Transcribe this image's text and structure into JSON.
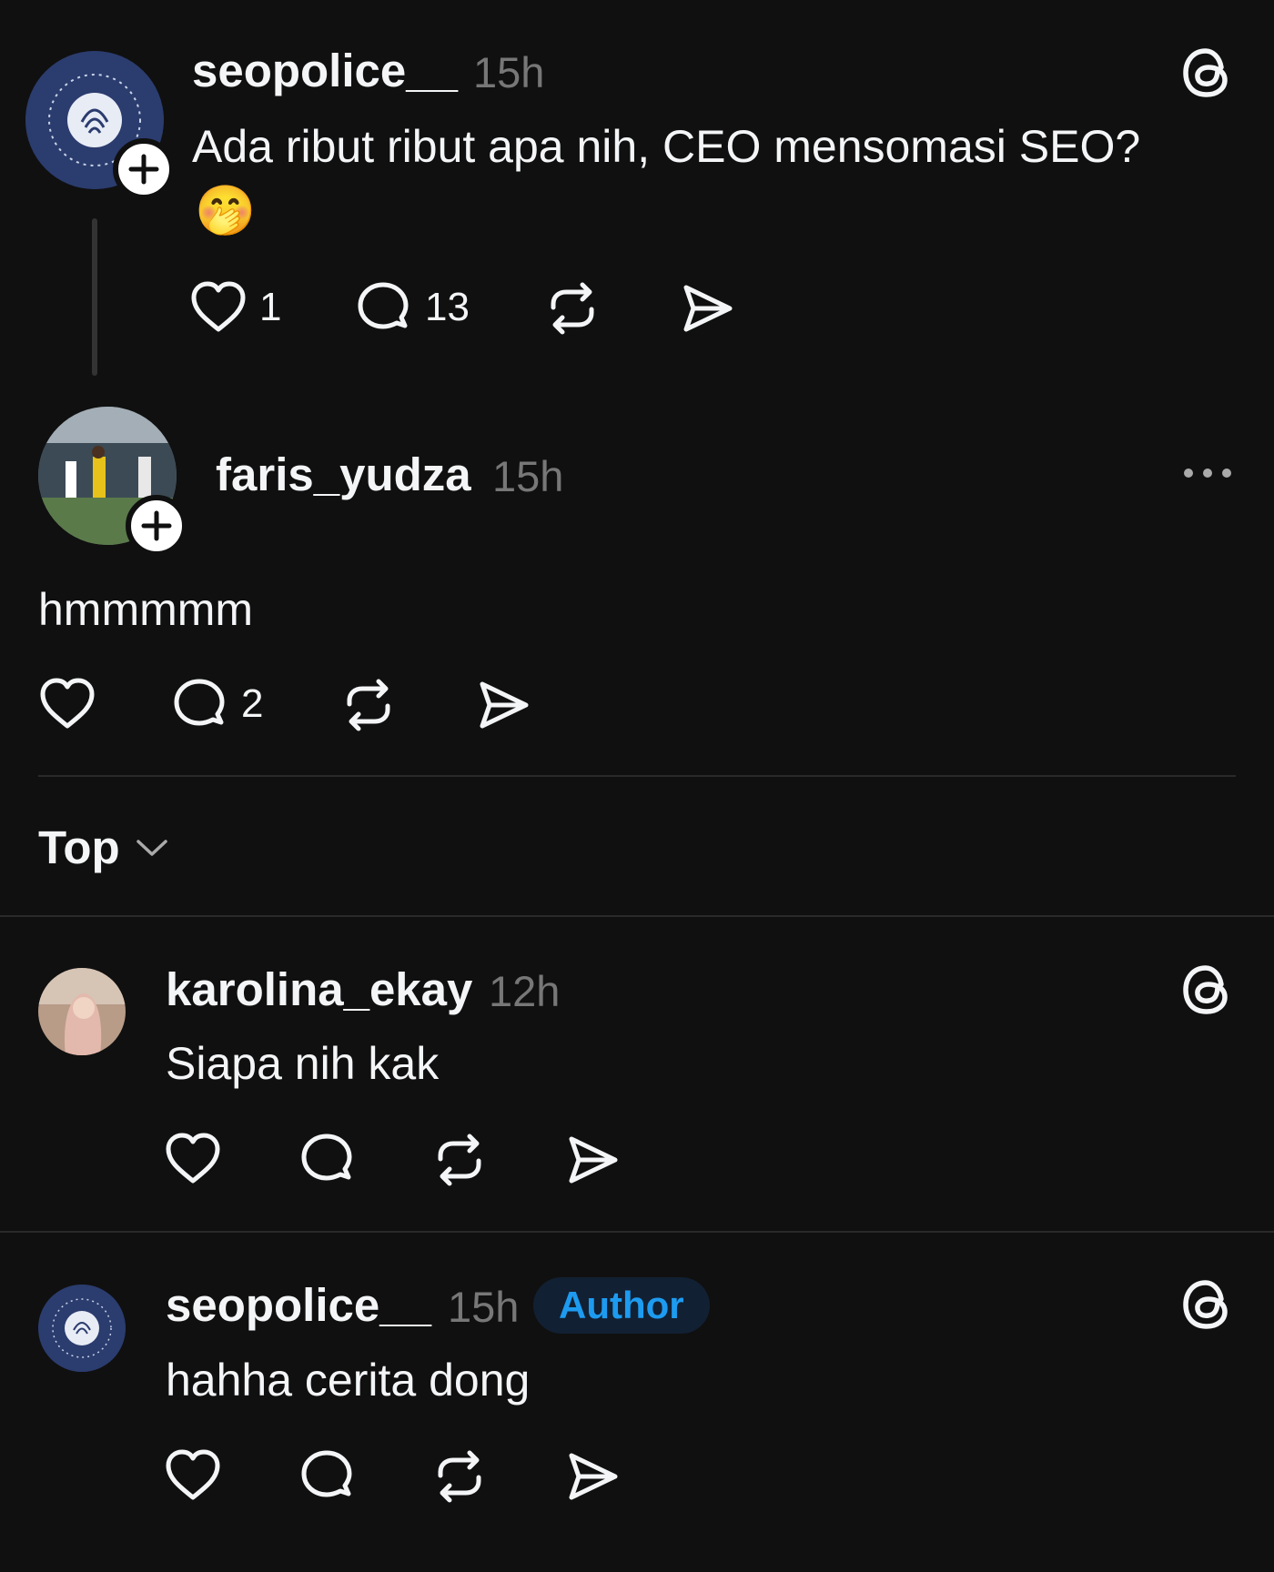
{
  "post": {
    "username": "seopolice__",
    "time": "15h",
    "text": "Ada ribut ribut apa nih, CEO mensomasi SEO?",
    "emoji": "🤭",
    "likes": "1",
    "replies": "13"
  },
  "reply": {
    "username": "faris_yudza",
    "time": "15h",
    "text": "hmmmmm",
    "replies": "2"
  },
  "sort": {
    "label": "Top"
  },
  "comments": [
    {
      "username": "karolina_ekay",
      "time": "12h",
      "text": "Siapa nih kak"
    },
    {
      "username": "seopolice__",
      "time": "15h",
      "badge": "Author",
      "text": "hahha cerita dong"
    }
  ],
  "colors": {
    "background": "#101010",
    "text": "#f3f5f7",
    "muted": "#777777",
    "author_badge_bg": "#122033",
    "author_badge_text": "#1d9bf0",
    "avatar_seo": "#2b3c6e"
  },
  "icons": {
    "threads": "threads-logo-icon",
    "like": "heart-icon",
    "reply": "comment-bubble-icon",
    "repost": "repost-icon",
    "share": "send-icon",
    "more": "more-dots-icon",
    "follow": "plus-icon",
    "sort": "chevron-down-icon"
  }
}
